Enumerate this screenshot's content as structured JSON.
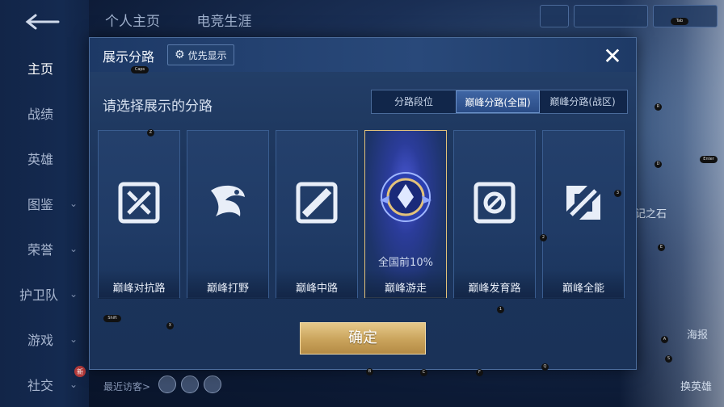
{
  "nav": {
    "items": [
      {
        "label": "主页",
        "active": true
      },
      {
        "label": "战绩"
      },
      {
        "label": "英雄"
      },
      {
        "label": "图鉴",
        "chev": "⌄"
      },
      {
        "label": "荣誉",
        "chev": "⌄"
      },
      {
        "label": "护卫队",
        "chev": "⌄"
      },
      {
        "label": "游戏",
        "chev": "⌄"
      },
      {
        "label": "社交",
        "chev": "⌄"
      }
    ],
    "social_badge": "新"
  },
  "top_tabs": [
    "个人主页",
    "电竞生涯"
  ],
  "recent_visitors": "最近访客>",
  "right_side": {
    "text1": "记之石",
    "text2": "海报",
    "text3": "换英雄"
  },
  "modal": {
    "title": "展示分路",
    "priority_button": "优先显示",
    "subtitle": "请选择展示的分路",
    "segments": [
      "分路段位",
      "巅峰分路(全国)",
      "巅峰分路(战区)"
    ],
    "active_segment": 1,
    "cards": [
      {
        "label": "巅峰对抗路"
      },
      {
        "label": "巅峰打野"
      },
      {
        "label": "巅峰中路"
      },
      {
        "label": "巅峰游走",
        "rank": "全国前10%",
        "selected": true
      },
      {
        "label": "巅峰发育路"
      },
      {
        "label": "巅峰全能"
      }
    ],
    "confirm": "确定"
  },
  "keyboard_hints": [
    "Caps",
    "Z",
    "X",
    "B",
    "C",
    "F",
    "Q",
    "1",
    "2",
    "3",
    "R",
    "D",
    "E",
    "A",
    "S",
    "Tab",
    "Shift",
    "Enter"
  ],
  "colors": {
    "accent_gold": "#e3c27a",
    "modal_bg": "#1c355c",
    "selected_glow": "#4b59d8"
  }
}
